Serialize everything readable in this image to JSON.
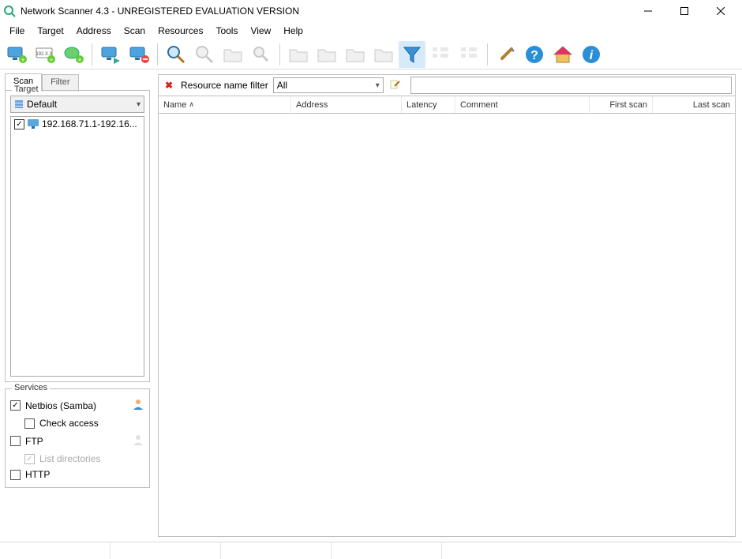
{
  "title": "Network Scanner 4.3 - UNREGISTERED EVALUATION VERSION",
  "menu": [
    "File",
    "Target",
    "Address",
    "Scan",
    "Resources",
    "Tools",
    "View",
    "Help"
  ],
  "tabs": {
    "scan": "Scan",
    "filter": "Filter"
  },
  "target": {
    "legend": "Target",
    "combo": "Default",
    "items": [
      "192.168.71.1-192.16..."
    ]
  },
  "services": {
    "legend": "Services",
    "netbios": {
      "label": "Netbios (Samba)",
      "checked": true
    },
    "check_access": {
      "label": "Check access",
      "checked": false
    },
    "ftp": {
      "label": "FTP",
      "checked": false
    },
    "list_dirs": {
      "label": "List directories",
      "checked": true,
      "disabled": true
    },
    "http": {
      "label": "HTTP",
      "checked": false
    }
  },
  "filter": {
    "label": "Resource name filter",
    "combo": "All",
    "input": ""
  },
  "columns": {
    "name": "Name",
    "address": "Address",
    "latency": "Latency",
    "comment": "Comment",
    "first": "First scan",
    "last": "Last scan"
  },
  "toolbar_icons": [
    "add-computer",
    "add-range",
    "add-subnet",
    "scan-list",
    "stop-scan",
    "sep",
    "find",
    "find-disabled",
    "folder-disabled",
    "search-disabled",
    "sep",
    "action1-disabled",
    "action2-disabled",
    "action3-disabled",
    "action4-disabled",
    "filter-funnel-active",
    "tree1-disabled",
    "tree2-disabled",
    "sep",
    "settings",
    "help",
    "home",
    "info"
  ]
}
